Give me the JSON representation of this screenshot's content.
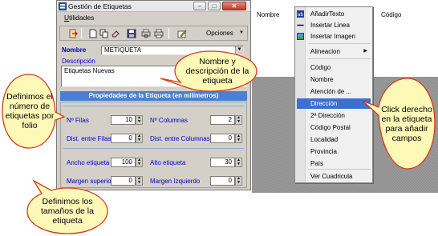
{
  "window": {
    "title": "Gestión de Etiquetas",
    "minimize_glyph": "–",
    "maximize_glyph": "□",
    "close_glyph": "✕"
  },
  "menubar": {
    "utilidades_accel": "U",
    "utilidades_rest": "tilidades"
  },
  "toolbar": {
    "icons": [
      "exit-icon",
      "new-document-icon",
      "copy-icon",
      "eraser-icon",
      "save-icon",
      "print-preview-icon",
      "print-icon",
      "edit-icon"
    ],
    "opciones_label": "Opciones",
    "opciones_arrow": "▼"
  },
  "form": {
    "nombre_label": "Nombre",
    "nombre_value": "METIQUETA",
    "descripcion_label": "Descripción",
    "descripcion_value": "Etiquetas Nuevas",
    "section_header": "Propiedades de la Etiqueta (en milímetros)"
  },
  "props": {
    "n_filas_label": "Nº Filas",
    "n_filas": "10",
    "n_columnas_label": "Nº Columnas",
    "n_columnas": "2",
    "dist_filas_label": "Dist. entre Filas",
    "dist_filas": "0",
    "dist_columnas_label": "Dist. entre Columnas",
    "dist_columnas": "0",
    "ancho_label": "Ancho etiqueta",
    "ancho": "100",
    "alto_label": "Alto etiqueta",
    "alto": "30",
    "margen_sup_label": "Margen superior",
    "margen_sup": "0",
    "margen_izq_label": "Margen Izquierdo",
    "margen_izq": "0",
    "up_arrow": "▲",
    "down_arrow": "▼"
  },
  "header_labels": {
    "nombre": "Nombre",
    "codigo": "Código"
  },
  "context_menu": {
    "items": [
      "AñadirTexto",
      "Insertar Linea",
      "Insertar Imagen",
      "Alineacion",
      "Código",
      "Nombre",
      "Atención de ...",
      "Dirección",
      "2ª Dirección",
      "Código Postal",
      "Localidad",
      "Provincia",
      "País",
      "Ver Cuadricula"
    ],
    "highlighted": "Dirección",
    "submenu_arrow": "▶"
  },
  "callouts": {
    "filas": "Definimos el número de etiquetas por folio",
    "nombre": "Nombre y descripción de la etiqueta",
    "click": "Click derecho en la etiqueta para añadir campos",
    "tamanos": "Definimos los tamaños de la etiqueta"
  },
  "colors": {
    "label_blue": "#0000cc",
    "header_blue": "#4a7fd4",
    "callout_fill": "#fff9b8",
    "callout_border": "#d63a1c",
    "menu_highlight": "#3b6fd0"
  }
}
